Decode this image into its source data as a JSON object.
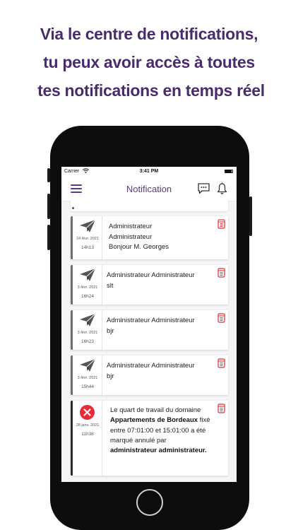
{
  "headline": {
    "line1": "Via le centre de notifications,",
    "line2": "tu peux avoir accès à toutes",
    "line3": "tes notifications en temps réel"
  },
  "statusbar": {
    "carrier": "Carrier",
    "time": "3:41 PM"
  },
  "appbar": {
    "title": "Notification",
    "menu_icon": "hamburger-menu-icon",
    "chat_icon": "chat-bubble-icon",
    "bell_icon": "bell-icon"
  },
  "colors": {
    "headline": "#4a2c6e",
    "accent": "#5b3b7e",
    "delete": "#e52d3a"
  },
  "notifications": [
    {
      "icon": "paper-plane-icon",
      "date": "24 févr. 2021",
      "time": "14h13",
      "line1": "Administrateur",
      "line2": "Administrateur",
      "line3": "Bonjour M. Georges"
    },
    {
      "icon": "paper-plane-icon",
      "date": "3 févr. 2021",
      "time": "16h24",
      "line1": "Administrateur Administrateur",
      "line2": "slt"
    },
    {
      "icon": "paper-plane-icon",
      "date": "3 févr. 2021",
      "time": "16h23",
      "line1": "Administrateur Administrateur",
      "line2": "bjr"
    },
    {
      "icon": "paper-plane-icon",
      "date": "3 févr. 2021",
      "time": "15h44",
      "line1": "Administrateur Administrateur",
      "line2": "bjr"
    },
    {
      "icon": "error-x-icon",
      "date": "28 janv. 2021",
      "time": "11h38",
      "p1": "Le quart de travail du domaine ",
      "b1": "Appartements de Bordeaux",
      "p2": " fixé entre 07:01:00 et 15:01:00 a été marqué annulé par ",
      "b2": "administrateur administrateur."
    }
  ]
}
